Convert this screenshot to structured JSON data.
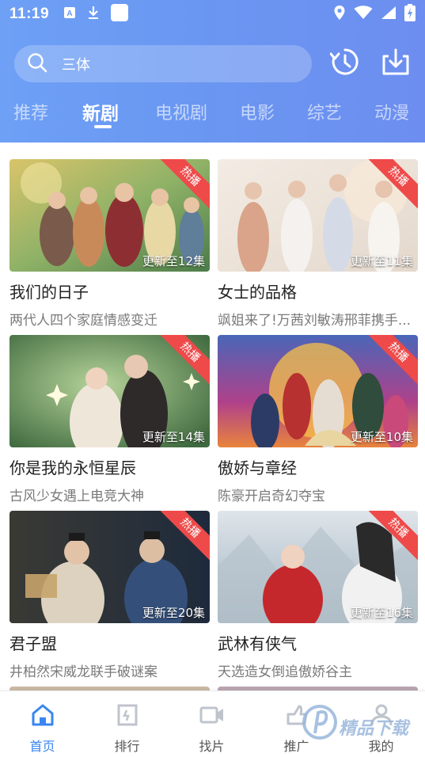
{
  "status_bar": {
    "time": "11:19"
  },
  "search": {
    "query": "三体"
  },
  "tabs": [
    {
      "label": "推荐"
    },
    {
      "label": "新剧"
    },
    {
      "label": "电视剧"
    },
    {
      "label": "电影"
    },
    {
      "label": "综艺"
    },
    {
      "label": "动漫"
    }
  ],
  "cards": [
    {
      "title": "我们的日子",
      "subtitle": "两代人四个家庭情感变迁",
      "update": "更新至12集",
      "badge": "热播"
    },
    {
      "title": "女士的品格",
      "subtitle": "飒姐来了!万茜刘敏涛邢菲携手...",
      "update": "更新至11集",
      "badge": "热播"
    },
    {
      "title": "你是我的永恒星辰",
      "subtitle": "古风少女遇上电竞大神",
      "update": "更新至14集",
      "badge": "热播"
    },
    {
      "title": "傲娇与章经",
      "subtitle": "陈豪开启奇幻夺宝",
      "update": "更新至10集",
      "badge": "热播"
    },
    {
      "title": "君子盟",
      "subtitle": "井柏然宋威龙联手破谜案",
      "update": "更新至20集",
      "badge": "热播"
    },
    {
      "title": "武林有侠气",
      "subtitle": "天选造女倒追傲娇谷主",
      "update": "更新至16集",
      "badge": "热播"
    }
  ],
  "bottom_nav": [
    {
      "label": "首页",
      "icon": "home-icon"
    },
    {
      "label": "排行",
      "icon": "ranking-icon"
    },
    {
      "label": "找片",
      "icon": "video-camera-icon"
    },
    {
      "label": "推广",
      "icon": "share-icon"
    },
    {
      "label": "我的",
      "icon": "profile-icon"
    }
  ],
  "watermark": {
    "text": "精品下载"
  },
  "colors": {
    "header": "#6a98f2",
    "accent": "#3a86f0",
    "badge": "#ee4a4a"
  }
}
